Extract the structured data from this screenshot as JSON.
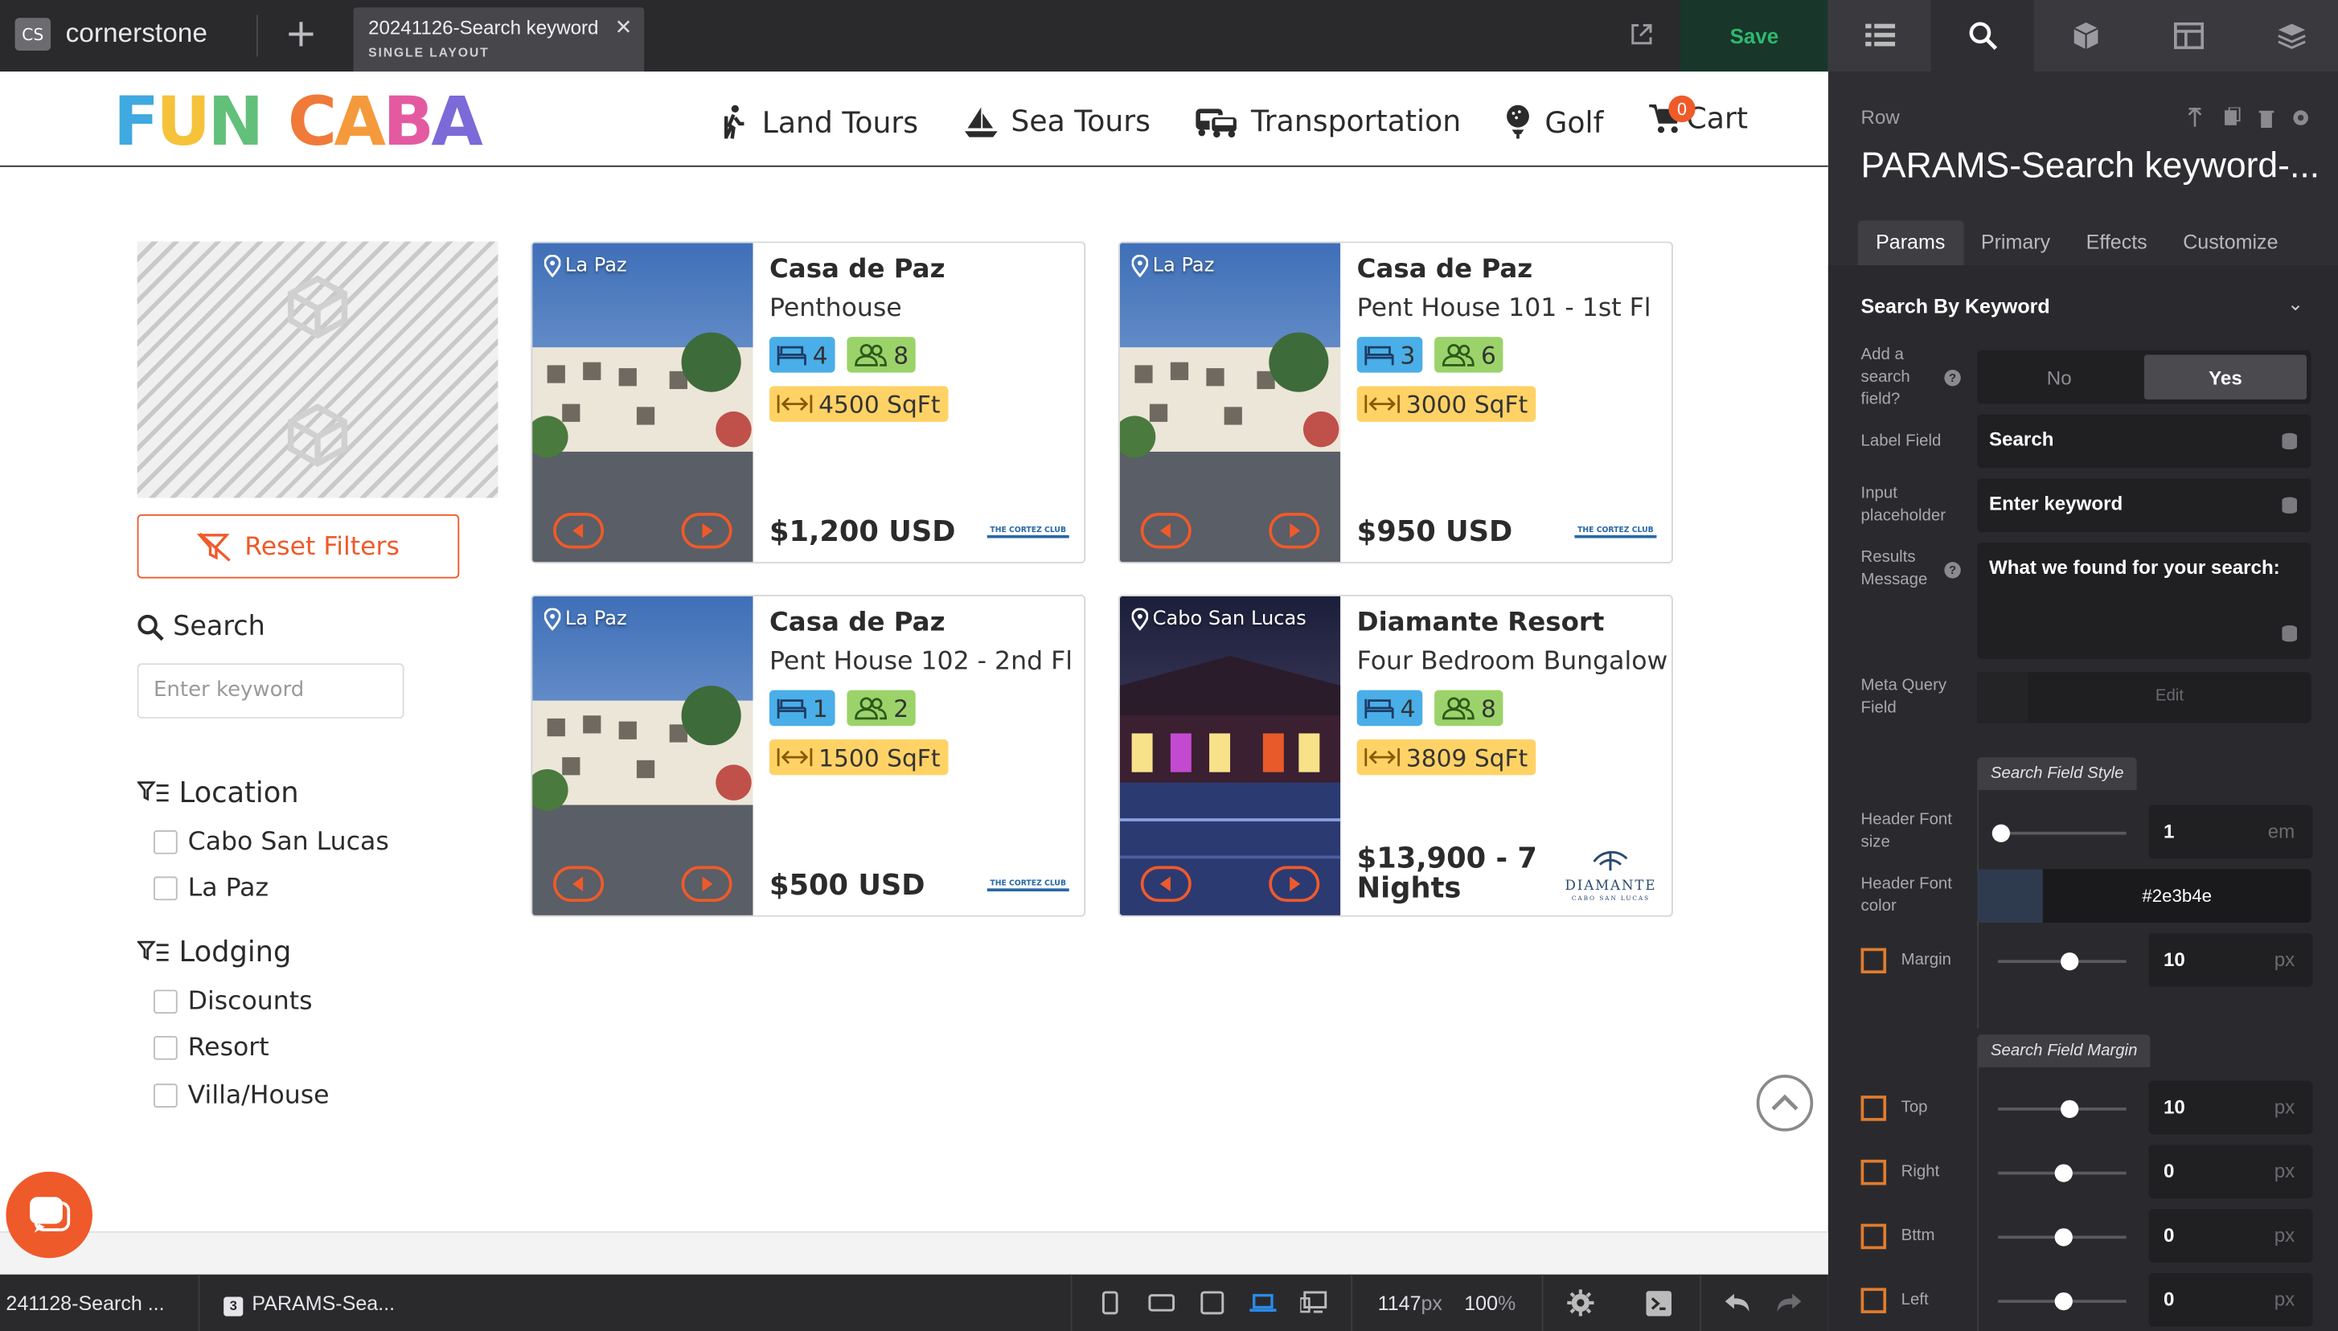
{
  "topbar": {
    "brand": "cornerstone",
    "brand_abbr": "CS",
    "tab_title": "20241126-Search keyword",
    "tab_subtitle": "SINGLE LAYOUT",
    "save_label": "Save"
  },
  "site": {
    "logo_text": [
      "F",
      "U",
      "N",
      " ",
      "C",
      "A",
      "B",
      "A"
    ],
    "logo_colors": [
      "#3fa9e0",
      "#f5c23a",
      "#63c07a",
      "#ffffff",
      "#ef7a3a",
      "#f59a3c",
      "#e45aa0",
      "#7b6ad8"
    ],
    "nav": [
      {
        "label": "Land Tours",
        "icon": "hiker-icon"
      },
      {
        "label": "Sea Tours",
        "icon": "sailboat-icon"
      },
      {
        "label": "Transportation",
        "icon": "bus-icon"
      },
      {
        "label": "Golf",
        "icon": "golf-icon"
      },
      {
        "label": "Cart",
        "icon": "cart-icon",
        "badge": "0"
      }
    ],
    "accent_color": "#ef5a2a"
  },
  "filters": {
    "reset_label": "Reset Filters",
    "search_label": "Search",
    "search_placeholder": "Enter keyword",
    "groups": [
      {
        "title": "Location",
        "options": [
          "Cabo San Lucas",
          "La Paz"
        ]
      },
      {
        "title": "Lodging",
        "options": [
          "Discounts",
          "Resort",
          "Villa/House"
        ]
      }
    ]
  },
  "cards": [
    {
      "location": "La Paz",
      "title": "Casa de Paz",
      "subtitle": "Penthouse",
      "beds": "4",
      "guests": "8",
      "sqft": "4500 SqFt",
      "price": "$1,200 USD",
      "brand": "THE CORTEZ CLUB"
    },
    {
      "location": "La Paz",
      "title": "Casa de Paz",
      "subtitle": "Pent House 101 - 1st Fl",
      "beds": "3",
      "guests": "6",
      "sqft": "3000 SqFt",
      "price": "$950 USD",
      "brand": "THE CORTEZ CLUB"
    },
    {
      "location": "La Paz",
      "title": "Casa de Paz",
      "subtitle": "Pent House 102 - 2nd Fl",
      "beds": "1",
      "guests": "2",
      "sqft": "1500 SqFt",
      "price": "$500 USD",
      "brand": "THE CORTEZ CLUB"
    },
    {
      "location": "Cabo San Lucas",
      "title": "Diamante Resort",
      "subtitle": "Four Bedroom Bungalow",
      "beds": "4",
      "guests": "8",
      "sqft": "3809 SqFt",
      "price_line1": "$13,900 - 7",
      "price_line2": "Nights",
      "brand": "DIAMANTE",
      "brand_sub": "CABO SAN LUCAS"
    }
  ],
  "panel": {
    "row_label": "Row",
    "title": "PARAMS-Search keyword-...",
    "tabs": [
      "Params",
      "Primary",
      "Effects",
      "Customize"
    ],
    "section_title": "Search By Keyword",
    "add_search_label": "Add a search field?",
    "toggle_no": "No",
    "toggle_yes": "Yes",
    "label_field_label": "Label Field",
    "label_field_value": "Search",
    "input_placeholder_label": "Input placeholder",
    "input_placeholder_value": "Enter keyword",
    "results_label": "Results Message",
    "results_value": "What we found for your search:",
    "meta_query_label": "Meta Query Field",
    "meta_edit": "Edit",
    "style_group": "Search Field Style",
    "header_font_size_label": "Header Font size",
    "header_font_size": "1",
    "header_font_size_unit": "em",
    "header_font_color_label": "Header Font color",
    "header_font_color": "#2e3b4e",
    "margin_label": "Margin",
    "margin_value": "10",
    "px": "px",
    "margin_group": "Search Field Margin",
    "top_label": "Top",
    "top_value": "10",
    "right_label": "Right",
    "right_value": "0",
    "bottom_label": "Bttm",
    "bottom_value": "0",
    "left_label": "Left",
    "left_value": "0"
  },
  "bottombar": {
    "crumb1": "241128-Search ...",
    "crumb2_badge": "3",
    "crumb2": "PARAMS-Sea...",
    "width": "1147",
    "width_unit": "px",
    "zoom": "100",
    "zoom_unit": "%"
  }
}
